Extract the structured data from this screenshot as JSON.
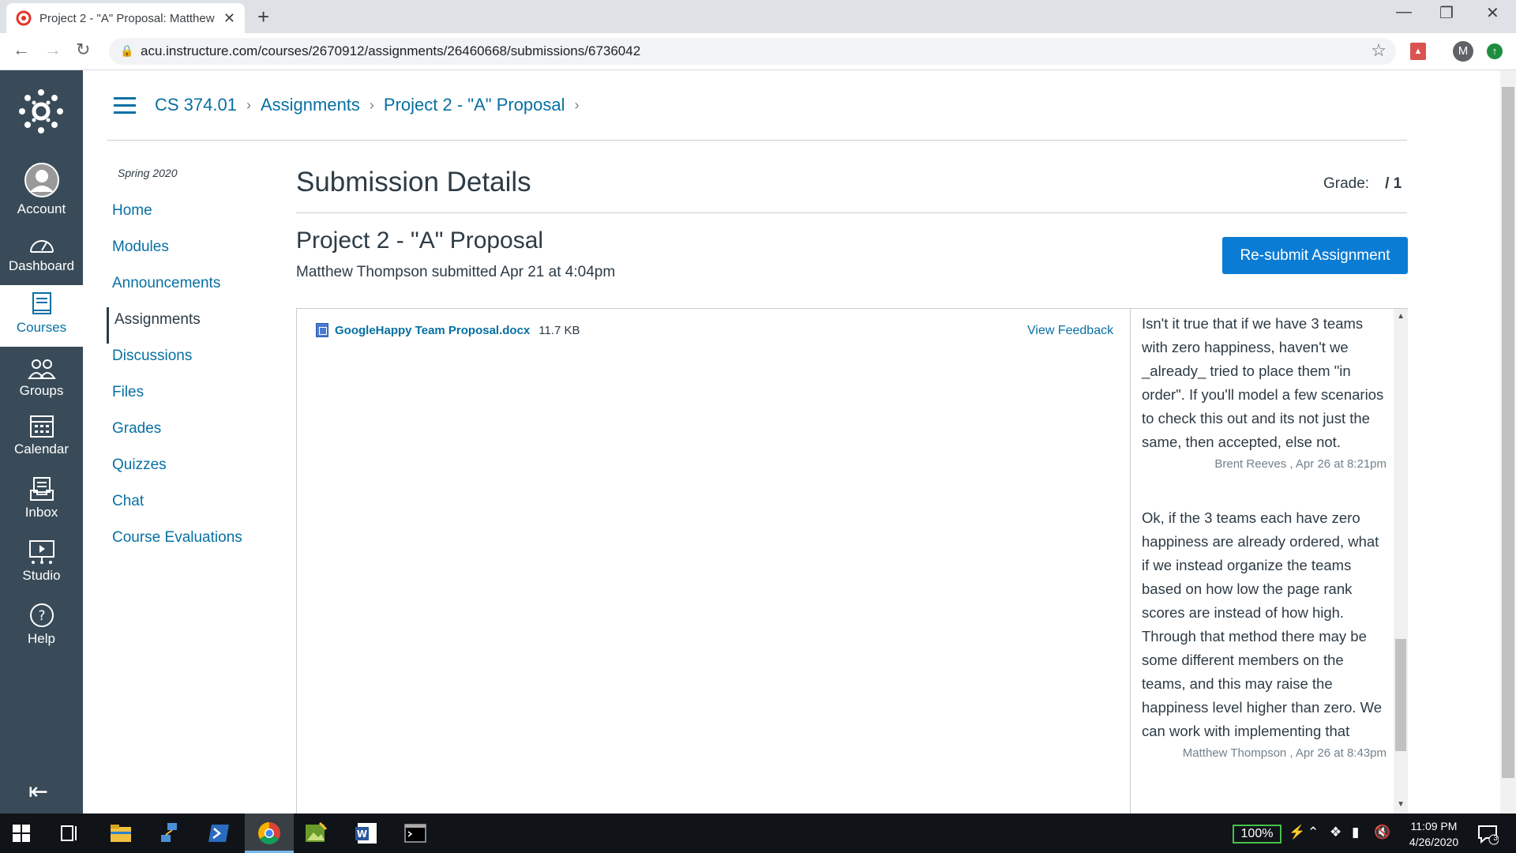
{
  "browser": {
    "tab_title": "Project 2 - \"A\" Proposal: Matthew",
    "tab_close": "✕",
    "new_tab": "+",
    "url": "acu.instructure.com/courses/2670912/assignments/26460668/submissions/6736042",
    "avatar_letter": "M"
  },
  "global_nav": {
    "account": "Account",
    "dashboard": "Dashboard",
    "courses": "Courses",
    "groups": "Groups",
    "calendar": "Calendar",
    "inbox": "Inbox",
    "studio": "Studio",
    "help": "Help"
  },
  "breadcrumb": {
    "course": "CS 374.01",
    "section": "Assignments",
    "item": "Project 2 - \"A\" Proposal"
  },
  "course_nav": {
    "term": "Spring 2020",
    "items": [
      "Home",
      "Modules",
      "Announcements",
      "Assignments",
      "Discussions",
      "Files",
      "Grades",
      "Quizzes",
      "Chat",
      "Course Evaluations"
    ]
  },
  "main": {
    "heading": "Submission Details",
    "grade_label": "Grade:",
    "grade_value": "/ 1",
    "assignment_title": "Project 2 - \"A\" Proposal",
    "submitted_text": "Matthew Thompson submitted Apr 21 at 4:04pm",
    "resubmit_label": "Re-submit Assignment",
    "file_name": "GoogleHappy Team Proposal.docx",
    "file_size": "11.7 KB",
    "view_feedback": "View Feedback"
  },
  "comments": [
    {
      "body": "Isn't it true that if we have 3 teams with zero happiness, haven't we _already_ tried to place them \"in order\".  If you'll model a few scenarios to check this out and its not just the same, then accepted, else not.",
      "meta": "Brent Reeves , Apr 26 at 8:21pm"
    },
    {
      "body": "Ok, if the 3 teams each have zero happiness are already ordered, what if we instead organize the teams based on how low the page rank scores are instead of how high. Through that method there may be some different members on the teams, and this may raise the happiness level higher than zero. We can work with implementing that",
      "meta": "Matthew Thompson , Apr 26 at 8:43pm"
    }
  ],
  "taskbar": {
    "battery": "100%",
    "time": "11:09 PM",
    "date": "4/26/2020",
    "notifications": "3"
  }
}
